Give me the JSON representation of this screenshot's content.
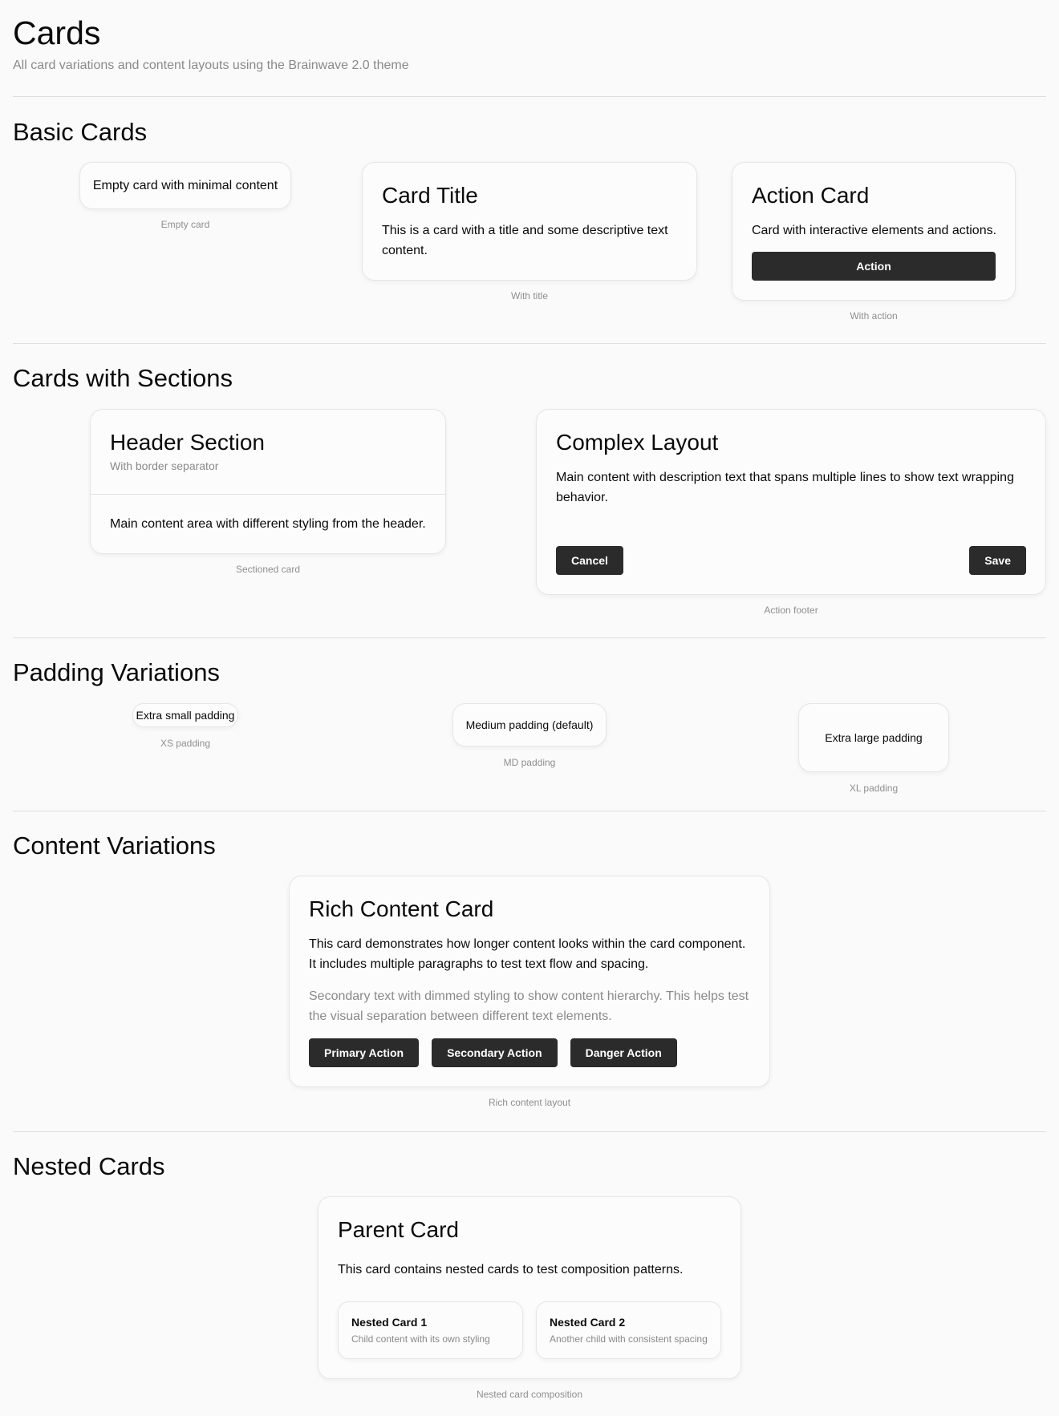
{
  "page": {
    "title": "Cards",
    "subtitle": "All card variations and content layouts using the Brainwave 2.0 theme"
  },
  "basic": {
    "title": "Basic Cards",
    "empty_text": "Empty card with minimal content",
    "empty_caption": "Empty card",
    "title_card_heading": "Card Title",
    "title_card_text": "This is a card with a title and some descriptive text content.",
    "title_caption": "With title",
    "action_card_heading": "Action Card",
    "action_card_text": "Card with interactive elements and actions.",
    "action_button": "Action",
    "action_caption": "With action"
  },
  "sections": {
    "title": "Cards with Sections",
    "header_heading": "Header Section",
    "header_sub": "With border separator",
    "header_body": "Main content area with different styling from the header.",
    "sectioned_caption": "Sectioned card",
    "complex_heading": "Complex Layout",
    "complex_text": "Main content with description text that spans multiple lines to show text wrapping behavior.",
    "cancel_button": "Cancel",
    "save_button": "Save",
    "footer_caption": "Action footer"
  },
  "padding": {
    "title": "Padding Variations",
    "xs_text": "Extra small padding",
    "xs_caption": "XS padding",
    "md_text": "Medium padding (default)",
    "md_caption": "MD padding",
    "xl_text": "Extra large padding",
    "xl_caption": "XL padding"
  },
  "content": {
    "title": "Content Variations",
    "rich_heading": "Rich Content Card",
    "rich_text": "This card demonstrates how longer content looks within the card component. It includes multiple paragraphs to test text flow and spacing.",
    "rich_secondary": "Secondary text with dimmed styling to show content hierarchy. This helps test the visual separation between different text elements.",
    "primary_button": "Primary Action",
    "secondary_button": "Secondary Action",
    "danger_button": "Danger Action",
    "rich_caption": "Rich content layout"
  },
  "nested": {
    "title": "Nested Cards",
    "parent_heading": "Parent Card",
    "parent_text": "This card contains nested cards to test composition patterns.",
    "child1_title": "Nested Card 1",
    "child1_text": "Child content with its own styling",
    "child2_title": "Nested Card 2",
    "child2_text": "Another child with consistent spacing",
    "nested_caption": "Nested card composition"
  }
}
